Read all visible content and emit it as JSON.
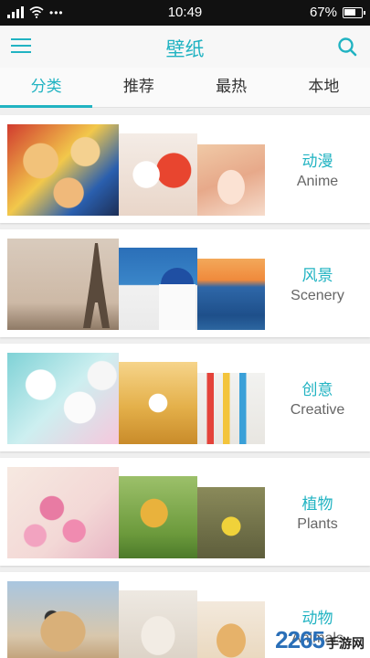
{
  "status": {
    "time": "10:49",
    "battery": "67%"
  },
  "app": {
    "title": "壁纸"
  },
  "tabs": [
    {
      "label": "分类"
    },
    {
      "label": "推荐"
    },
    {
      "label": "最热"
    },
    {
      "label": "本地"
    }
  ],
  "categories": [
    {
      "cn": "动漫",
      "en": "Anime"
    },
    {
      "cn": "风景",
      "en": "Scenery"
    },
    {
      "cn": "创意",
      "en": "Creative"
    },
    {
      "cn": "植物",
      "en": "Plants"
    },
    {
      "cn": "动物",
      "en": "Animals"
    }
  ],
  "watermark": {
    "brand": "2265",
    "suffix": "手游网"
  },
  "colors": {
    "accent": "#21b3c2"
  },
  "icons": {
    "menu": "menu-icon",
    "search": "search-icon"
  }
}
